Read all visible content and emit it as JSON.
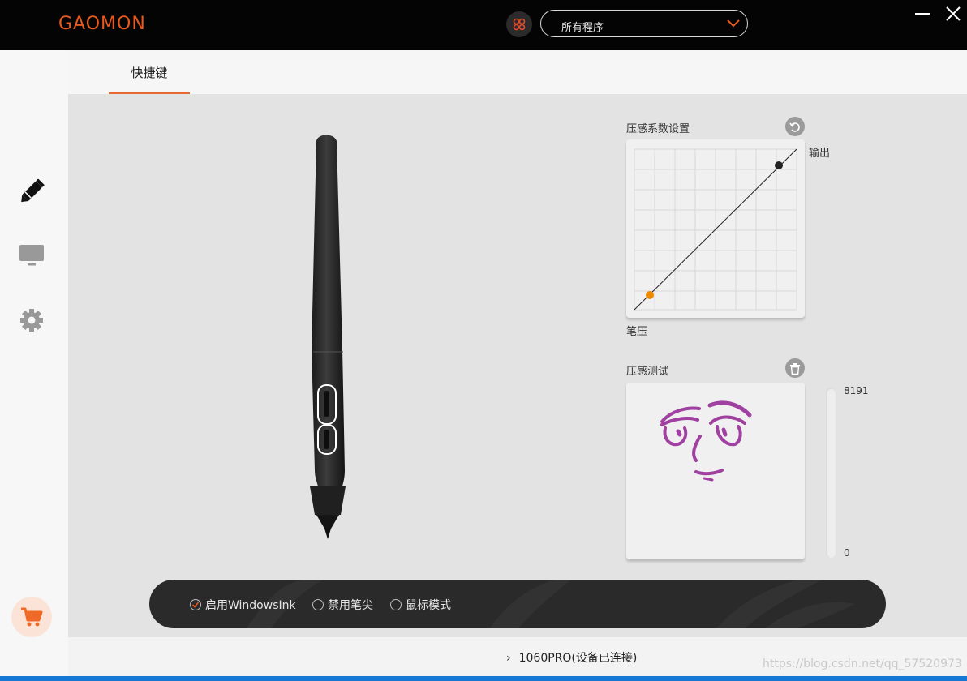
{
  "app": {
    "logo_text": "GAOMON",
    "program_select": {
      "value": "所有程序",
      "icon": "app-grid-icon"
    },
    "window_controls": [
      "minimize-icon",
      "close-icon"
    ]
  },
  "sidebar": {
    "items": [
      {
        "name": "pen",
        "icon": "pen-icon",
        "active": true
      },
      {
        "name": "display",
        "icon": "monitor-icon",
        "active": false
      },
      {
        "name": "settings",
        "icon": "gear-icon",
        "active": false
      }
    ],
    "shop_icon": "cart-icon"
  },
  "tabs": [
    {
      "label": "快捷键",
      "active": true
    }
  ],
  "pressure_curve": {
    "title": "压感系数设置",
    "reset_icon": "undo-icon",
    "output_label": "输出",
    "input_label": "笔压"
  },
  "pressure_test": {
    "title": "压感测试",
    "clear_icon": "trash-icon",
    "max_value": "8191",
    "min_value": "0"
  },
  "options": [
    {
      "label": "启用WindowsInk",
      "checked": true
    },
    {
      "label": "禁用笔尖",
      "checked": false
    },
    {
      "label": "鼠标模式",
      "checked": false
    }
  ],
  "footer": {
    "device_status": "1060PRO(设备已连接)",
    "watermark": "https://blog.csdn.net/qq_57520973"
  },
  "colors": {
    "accent": "#e8591d",
    "titlebar": "#040404",
    "options_bar": "#2a2a2a",
    "stroke": "#a040a0"
  }
}
